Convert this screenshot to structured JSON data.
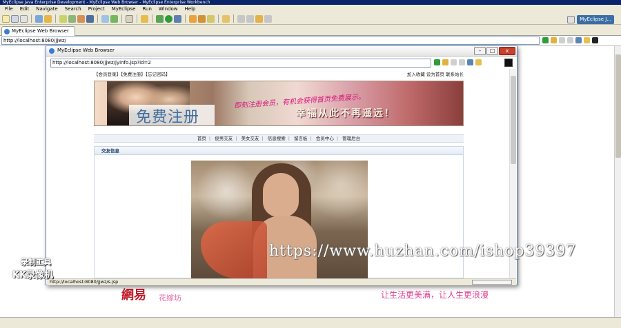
{
  "window": {
    "title": "MyEclipse Java Enterprise Development - MyEclipse Web Browser - MyEclipse Enterprise Workbench"
  },
  "menu": [
    "File",
    "Edit",
    "Navigate",
    "Search",
    "Project",
    "MyEclipse",
    "Run",
    "Window",
    "Help"
  ],
  "perspective": {
    "label": "MyEclipse J..."
  },
  "editor_tab": {
    "label": "MyEclipse Web Browser"
  },
  "main_browser": {
    "url": "http://localhost:8080/jjwz/"
  },
  "background_page": {
    "footer_logo": "網易",
    "footer_sub": "花嫁坊",
    "footer_slogan": "让生活更美满，让人生更浪漫"
  },
  "popup": {
    "title": "MyEclipse Web Browser",
    "url": "http://localhost:8080/jjwz/jyinfo.jsp?id=2",
    "status_url": "http://localhost:8080/jjwz/s.jsp",
    "buttons": {
      "minimize": "–",
      "maximize": "□",
      "close": "x"
    }
  },
  "site": {
    "top_left": "【会员登录】【免费注册】【忘记密码】",
    "top_right": "加入收藏 设为首页 联系站长",
    "banner": {
      "register": "免费注册",
      "promo": "即刻注册会员，有机会获得首页免费展示。",
      "slogan": "幸福从此不再遥远！"
    },
    "nav": [
      "首页",
      "俊男交友",
      "美女交友",
      "信息搜索",
      "留言板",
      "会员中心",
      "管理后台"
    ],
    "section_title": "交友信息"
  },
  "overlays": {
    "recorder_line1": "录制工具",
    "recorder_line2": "KK录像机",
    "watermark_url": "https://www.huzhan.com/ishop39397"
  },
  "colors": {
    "accent": "#3a6ea5",
    "banner_pink": "#d8147a",
    "register_blue": "#3f6e9e",
    "close_red": "#c8412c"
  }
}
